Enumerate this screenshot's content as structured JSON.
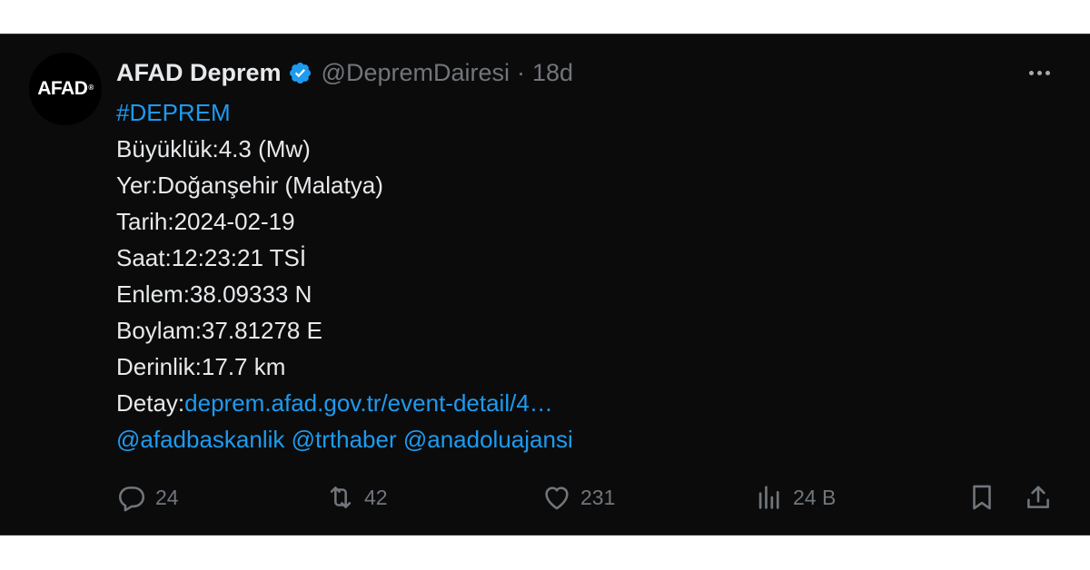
{
  "author": {
    "avatar_text": "AFAD",
    "avatar_mark": "®",
    "name": "AFAD Deprem",
    "verified_icon": "verified-badge-icon",
    "handle": "@DepremDairesi",
    "separator": "·",
    "time": "18d"
  },
  "tweet": {
    "hashtag": "#DEPREM",
    "lines": [
      "Büyüklük:4.3 (Mw)",
      "Yer:Doğanşehir (Malatya)",
      "Tarih:2024-02-19",
      "Saat:12:23:21 TSİ",
      "Enlem:38.09333 N",
      "Boylam:37.81278 E",
      "Derinlik:17.7 km"
    ],
    "detail_label": "Detay:",
    "detail_link": "deprem.afad.gov.tr/event-detail/4…",
    "mentions": [
      "@afadbaskanlik",
      "@trthaber",
      "@anadoluajansi"
    ]
  },
  "actions": {
    "replies": "24",
    "reposts": "42",
    "likes": "231",
    "views": "24 B"
  },
  "colors": {
    "background": "#0b0b0c",
    "text": "#e7e9ea",
    "muted": "#71767b",
    "link": "#1d9bf0"
  }
}
